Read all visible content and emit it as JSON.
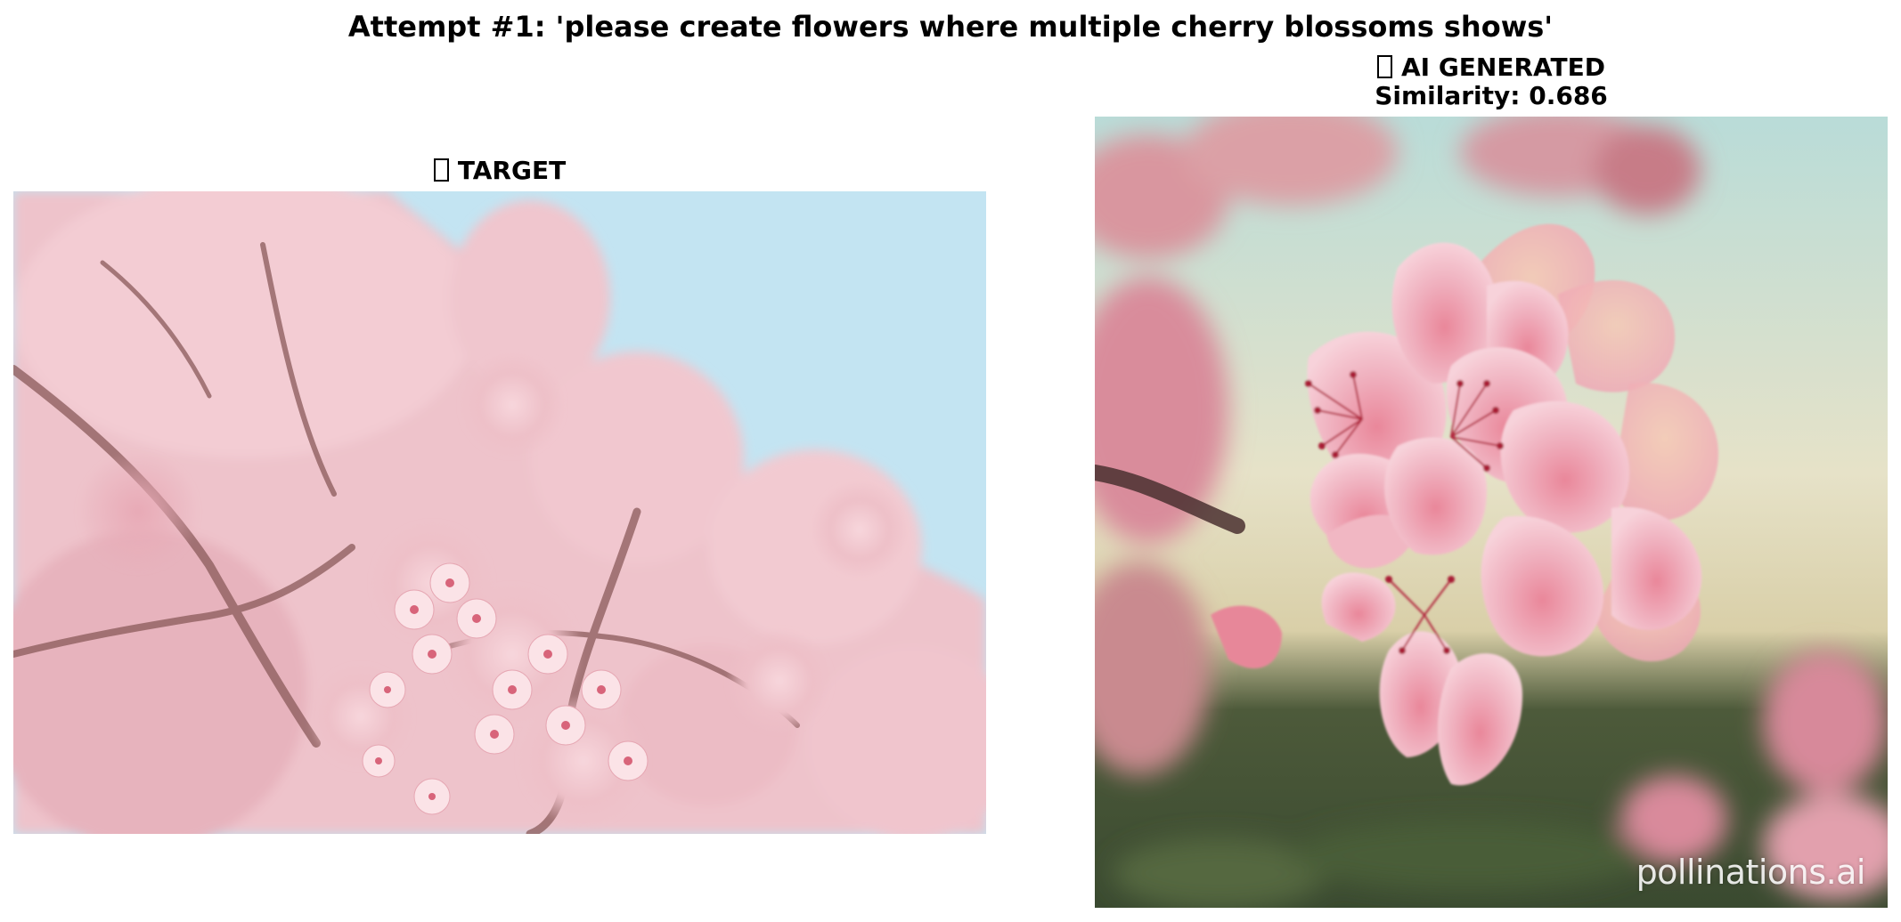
{
  "figure": {
    "title": "Attempt #1: 'please create flowers where multiple cherry blossoms shows'"
  },
  "panels": {
    "target": {
      "label": "TARGET",
      "icon": "target-icon"
    },
    "generated": {
      "label": "AI GENERATED",
      "icon": "robot-icon",
      "similarity": "Similarity: 0.686",
      "watermark": "pollinations.ai"
    }
  },
  "colors": {
    "sky": "#c3e4f2",
    "blossom_pink": "#f2c4cc",
    "blossom_deep": "#d98b98",
    "branch": "#8a5a5a"
  }
}
